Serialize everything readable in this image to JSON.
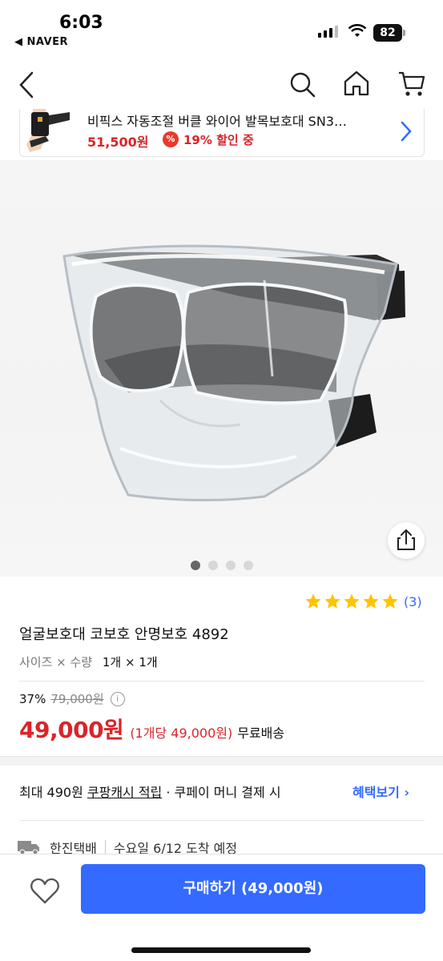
{
  "status_bar": {
    "time": "6:03",
    "back_app": "◀ NAVER",
    "battery": "82"
  },
  "nav": {
    "back_icon": "chevron-left-icon",
    "search_icon": "search-icon",
    "home_icon": "home-icon",
    "cart_icon": "cart-icon"
  },
  "recommendation": {
    "title": "비픽스 자동조절 버클 와이어 발목보호대 SN3…",
    "price": "51,500원",
    "discount": "19% 할인 중"
  },
  "gallery": {
    "image_count": 4,
    "active_index": 0
  },
  "product": {
    "rating_stars": 5,
    "review_count": "(3)",
    "name": "얼굴보호대 코보호 안명보호 4892",
    "option_label": "사이즈 × 수량",
    "option_value": "1개 × 1개",
    "discount_rate": "37%",
    "original_price": "79,000원",
    "sale_price": "49,000원",
    "unit_price": "(1개당 49,000원)",
    "shipping": "무료배송"
  },
  "benefit": {
    "prefix": "최대 490원 ",
    "cash_link": "쿠팡캐시 적립",
    "suffix": " · 쿠페이 머니 결제 시",
    "link_label": "혜택보기 ›"
  },
  "delivery": {
    "carrier": "한진택배",
    "eta": "수요일 6/12 도착 예정"
  },
  "bottom": {
    "buy_label": "구매하기 (49,000원)"
  },
  "colors": {
    "accent_blue": "#346aff",
    "price_red": "#d9252a",
    "star_yellow": "#ffc300"
  }
}
